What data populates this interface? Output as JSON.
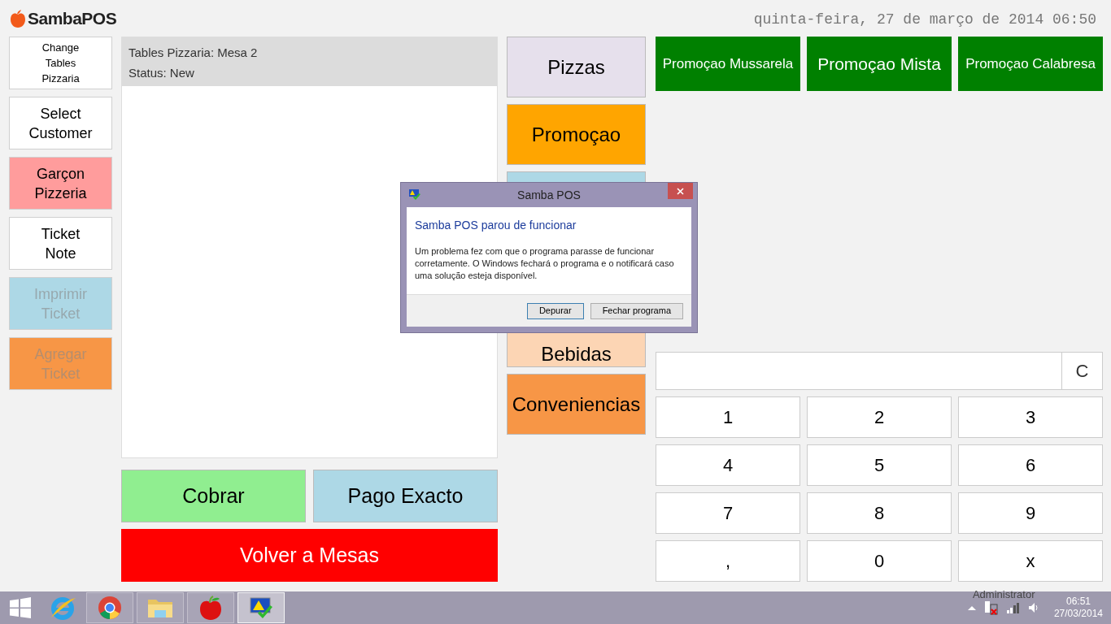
{
  "header": {
    "logo": "SambaPOS",
    "datetime": "quinta-feira, 27 de março de 2014 06:50"
  },
  "left_buttons": [
    {
      "label": "Change Tables Pizzaria",
      "color": "#ffffff",
      "disabled": false,
      "small": true
    },
    {
      "label": "Select Customer",
      "color": "#ffffff",
      "disabled": false,
      "small": false
    },
    {
      "label": "Garçon Pizzeria",
      "color": "#ff9c9c",
      "disabled": false,
      "small": false
    },
    {
      "label": "Ticket Note",
      "color": "#ffffff",
      "disabled": false,
      "small": false
    },
    {
      "label": "Imprimir Ticket",
      "color": "#add8e6",
      "disabled": true,
      "small": false
    },
    {
      "label": "Agregar Ticket",
      "color": "#f79646",
      "disabled": true,
      "small": false
    }
  ],
  "ticket": {
    "title": "Tables Pizzaria: Mesa 2",
    "status": "Status: New"
  },
  "ticket_actions": [
    {
      "label": "Cobrar",
      "color": "#90ee90"
    },
    {
      "label": "Pago Exacto",
      "color": "#add8e6"
    }
  ],
  "back_button": {
    "label": "Volver a Mesas",
    "color": "#ff0000"
  },
  "categories": [
    {
      "label": "Pizzas",
      "color": "#e6e0ec"
    },
    {
      "label": "Promoçao",
      "color": "#ffa500"
    },
    {
      "color": "#add8e6"
    },
    {
      "label": "Bebidas",
      "color": "#fcd5b4"
    },
    {
      "label": "Conveniencias",
      "color": "#f79646"
    }
  ],
  "products": [
    {
      "label": "Promoçao Mussarela",
      "big": false
    },
    {
      "label": "Promoçao Mista",
      "big": true
    },
    {
      "label": "Promoçao Calabresa",
      "big": false
    }
  ],
  "numpad": {
    "clear": "C",
    "keys": [
      "1",
      "2",
      "3",
      "4",
      "5",
      "6",
      "7",
      "8",
      "9",
      ",",
      "0",
      "x"
    ]
  },
  "dialog": {
    "title": "Samba POS",
    "heading": "Samba POS parou de funcionar",
    "message": "Um problema fez com que o programa parasse de funcionar corretamente. O Windows fechará o programa e o notificará caso uma solução esteja disponível.",
    "buttons": [
      {
        "label": "Depurar",
        "selected": true
      },
      {
        "label": "Fechar programa",
        "selected": false
      }
    ]
  },
  "taskbar": {
    "apps": [
      {
        "selected": false
      },
      {
        "selected": false
      },
      {
        "selected": false
      },
      {
        "selected": false
      },
      {
        "selected": true
      }
    ],
    "user": "Administrator",
    "time": "06:51",
    "date": "27/03/2014"
  }
}
